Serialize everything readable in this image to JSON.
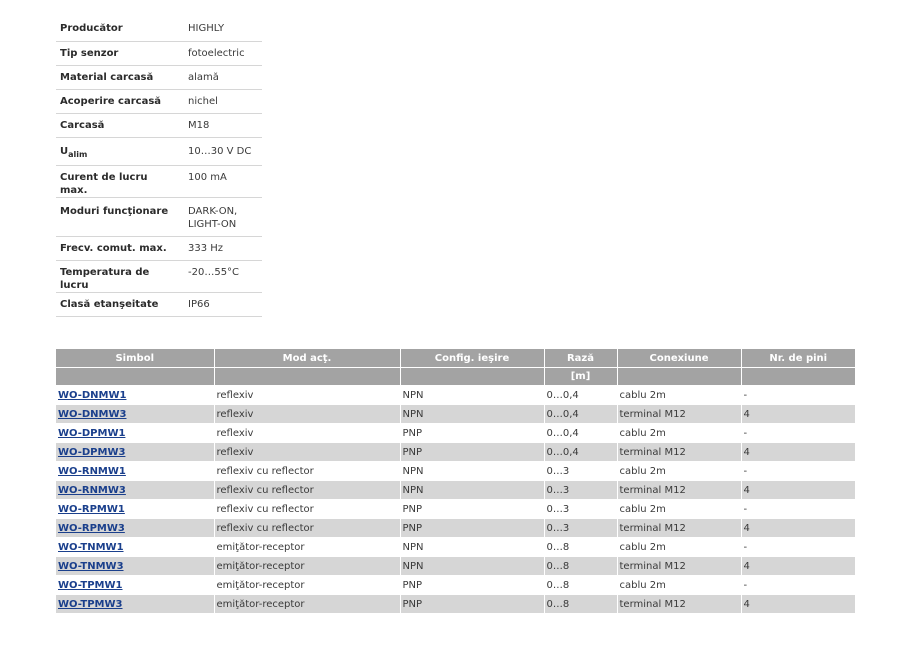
{
  "specs": [
    {
      "key": "Producător",
      "value": "HIGHLY"
    },
    {
      "key": "Tip senzor",
      "value": "fotoelectric"
    },
    {
      "key": "Material carcasă",
      "value": "alamă"
    },
    {
      "key": "Acoperire carcasă",
      "value": "nichel"
    },
    {
      "key": "Carcasă",
      "value": "M18"
    },
    {
      "key": "U",
      "key_sub": "alim",
      "value": "10…30 V DC"
    },
    {
      "key": "Curent de lucru max.",
      "value": "100 mA"
    },
    {
      "key": "Moduri funcţionare",
      "value": "DARK-ON,",
      "value2": "LIGHT-ON"
    },
    {
      "key": "Frecv. comut. max.",
      "value": "333 Hz"
    },
    {
      "key": "Temperatura de lucru",
      "value": "-20…55°C"
    },
    {
      "key": "Clasă etanşeitate",
      "value": "IP66"
    }
  ],
  "products": {
    "headers": [
      "Simbol",
      "Mod acţ.",
      "Config. ieşire",
      "Rază",
      "Conexiune",
      "Nr. de pini"
    ],
    "units": [
      "",
      "",
      "",
      "[m]",
      "",
      ""
    ],
    "rows": [
      {
        "symbol": "WO-DNMW1",
        "mode": "reflexiv",
        "output": "NPN",
        "range": "0…0,4",
        "connection": "cablu 2m",
        "pins": "-"
      },
      {
        "symbol": "WO-DNMW3",
        "mode": "reflexiv",
        "output": "NPN",
        "range": "0…0,4",
        "connection": "terminal M12",
        "pins": "4"
      },
      {
        "symbol": "WO-DPMW1",
        "mode": "reflexiv",
        "output": "PNP",
        "range": "0…0,4",
        "connection": "cablu 2m",
        "pins": "-"
      },
      {
        "symbol": "WO-DPMW3",
        "mode": "reflexiv",
        "output": "PNP",
        "range": "0…0,4",
        "connection": "terminal M12",
        "pins": "4"
      },
      {
        "symbol": "WO-RNMW1",
        "mode": "reflexiv cu reflector",
        "output": "NPN",
        "range": "0…3",
        "connection": "cablu 2m",
        "pins": "-"
      },
      {
        "symbol": "WO-RNMW3",
        "mode": "reflexiv cu reflector",
        "output": "NPN",
        "range": "0…3",
        "connection": "terminal M12",
        "pins": "4"
      },
      {
        "symbol": "WO-RPMW1",
        "mode": "reflexiv cu reflector",
        "output": "PNP",
        "range": "0…3",
        "connection": "cablu 2m",
        "pins": "-"
      },
      {
        "symbol": "WO-RPMW3",
        "mode": "reflexiv cu reflector",
        "output": "PNP",
        "range": "0…3",
        "connection": "terminal M12",
        "pins": "4"
      },
      {
        "symbol": "WO-TNMW1",
        "mode": "emiţător-receptor",
        "output": "NPN",
        "range": "0…8",
        "connection": "cablu 2m",
        "pins": "-"
      },
      {
        "symbol": "WO-TNMW3",
        "mode": "emiţător-receptor",
        "output": "NPN",
        "range": "0…8",
        "connection": "terminal M12",
        "pins": "4"
      },
      {
        "symbol": "WO-TPMW1",
        "mode": "emiţător-receptor",
        "output": "PNP",
        "range": "0…8",
        "connection": "cablu 2m",
        "pins": "-"
      },
      {
        "symbol": "WO-TPMW3",
        "mode": "emiţător-receptor",
        "output": "PNP",
        "range": "0…8",
        "connection": "terminal M12",
        "pins": "4"
      }
    ]
  },
  "colors": {
    "header_bg": "#a3a3a3",
    "alt_row_bg": "#d6d6d6",
    "link": "#1a3f8c"
  }
}
